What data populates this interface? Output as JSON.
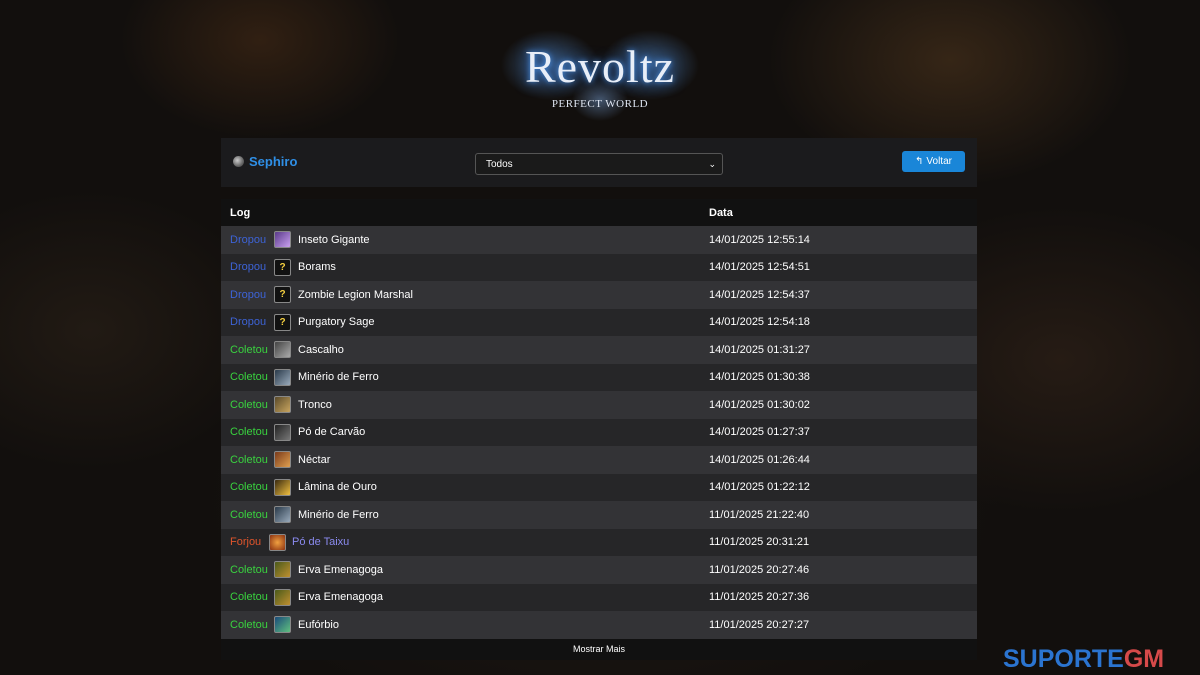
{
  "logo": {
    "title": "Revoltz",
    "subtitle": "PERFECT WORLD"
  },
  "character": {
    "name": "Sephiro"
  },
  "filter": {
    "selected": "Todos"
  },
  "back_button": {
    "label": "Voltar",
    "icon": "return-arrow-icon"
  },
  "table": {
    "headers": {
      "log": "Log",
      "date": "Data"
    },
    "rows": [
      {
        "action": "Dropou",
        "item": "Inseto Gigante",
        "date": "14/01/2025 12:55:14"
      },
      {
        "action": "Dropou",
        "item": "Borams",
        "date": "14/01/2025 12:54:51"
      },
      {
        "action": "Dropou",
        "item": "Zombie Legion Marshal",
        "date": "14/01/2025 12:54:37"
      },
      {
        "action": "Dropou",
        "item": "Purgatory Sage",
        "date": "14/01/2025 12:54:18"
      },
      {
        "action": "Coletou",
        "item": "Cascalho",
        "date": "14/01/2025 01:31:27"
      },
      {
        "action": "Coletou",
        "item": "Minério de Ferro",
        "date": "14/01/2025 01:30:38"
      },
      {
        "action": "Coletou",
        "item": "Tronco",
        "date": "14/01/2025 01:30:02"
      },
      {
        "action": "Coletou",
        "item": "Pó de Carvão",
        "date": "14/01/2025 01:27:37"
      },
      {
        "action": "Coletou",
        "item": "Néctar",
        "date": "14/01/2025 01:26:44"
      },
      {
        "action": "Coletou",
        "item": "Lâmina de Ouro",
        "date": "14/01/2025 01:22:12"
      },
      {
        "action": "Coletou",
        "item": "Minério de Ferro",
        "date": "11/01/2025 21:22:40"
      },
      {
        "action": "Forjou",
        "item": "Pó de Taixu",
        "date": "11/01/2025 20:31:21"
      },
      {
        "action": "Coletou",
        "item": "Erva Emenagoga",
        "date": "11/01/2025 20:27:46"
      },
      {
        "action": "Coletou",
        "item": "Erva Emenagoga",
        "date": "11/01/2025 20:27:36"
      },
      {
        "action": "Coletou",
        "item": "Eufórbio",
        "date": "11/01/2025 20:27:27"
      }
    ],
    "show_more": "Mostrar Mais"
  },
  "colors": {
    "Dropou": "#3d63d6",
    "Coletou": "#39d23f",
    "Forjou": "#e0552c",
    "forged_item": "#8b8bf0",
    "accent": "#1a86d8"
  },
  "watermark": {
    "part1": "SUPORTE",
    "part2": "GM"
  }
}
